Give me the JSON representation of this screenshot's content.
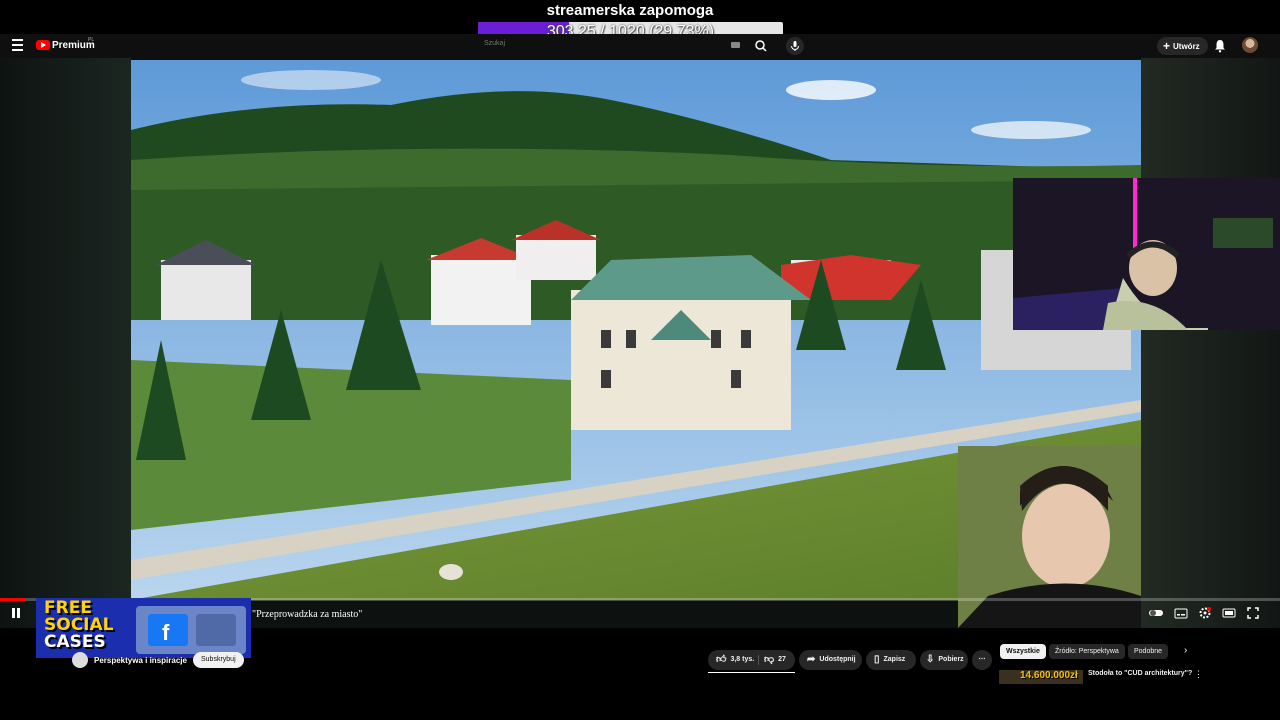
{
  "overlay": {
    "goal_title": "streamerska zapomoga",
    "goal_text": "303.25 / 1020 (29.73%)",
    "goal_progress": 0.2973,
    "goal_color": "#6a1fd6"
  },
  "topbar": {
    "logo_text": "Premium",
    "region": "PL",
    "search_placeholder": "Szukaj",
    "create_label": "Utwórz",
    "icons": [
      "menu-icon",
      "youtube-logo-icon",
      "keyboard-icon",
      "search-icon",
      "mic-icon",
      "bell-icon",
      "avatar"
    ]
  },
  "player": {
    "chapter_title": "\"Przeprowadzka za miasto\"",
    "progress": 0.02,
    "progress_color": "#ff0000",
    "controls": [
      "pause-icon",
      "autoplay-toggle-icon",
      "subtitles-icon",
      "settings-icon",
      "theater-mode-icon",
      "fullscreen-icon"
    ]
  },
  "promo": {
    "line1": "FREE",
    "line2": "SOCIAL",
    "line3": "CASES"
  },
  "channel": {
    "name": "Perspektywa i inspiracje",
    "subscribe_label": "Subskrybuj"
  },
  "actions": {
    "likes": "3,8 tys.",
    "dislikes": "27",
    "share": "Udostępnij",
    "save": "Zapisz",
    "download": "Pobierz",
    "more": "⋯"
  },
  "chips": [
    "Wszystkie",
    "Źródło: Perspektywa",
    "Podobne"
  ],
  "recommendation": {
    "views": "14.600.000zł",
    "title": "Stodoła to \"CUD architektury\"?"
  }
}
